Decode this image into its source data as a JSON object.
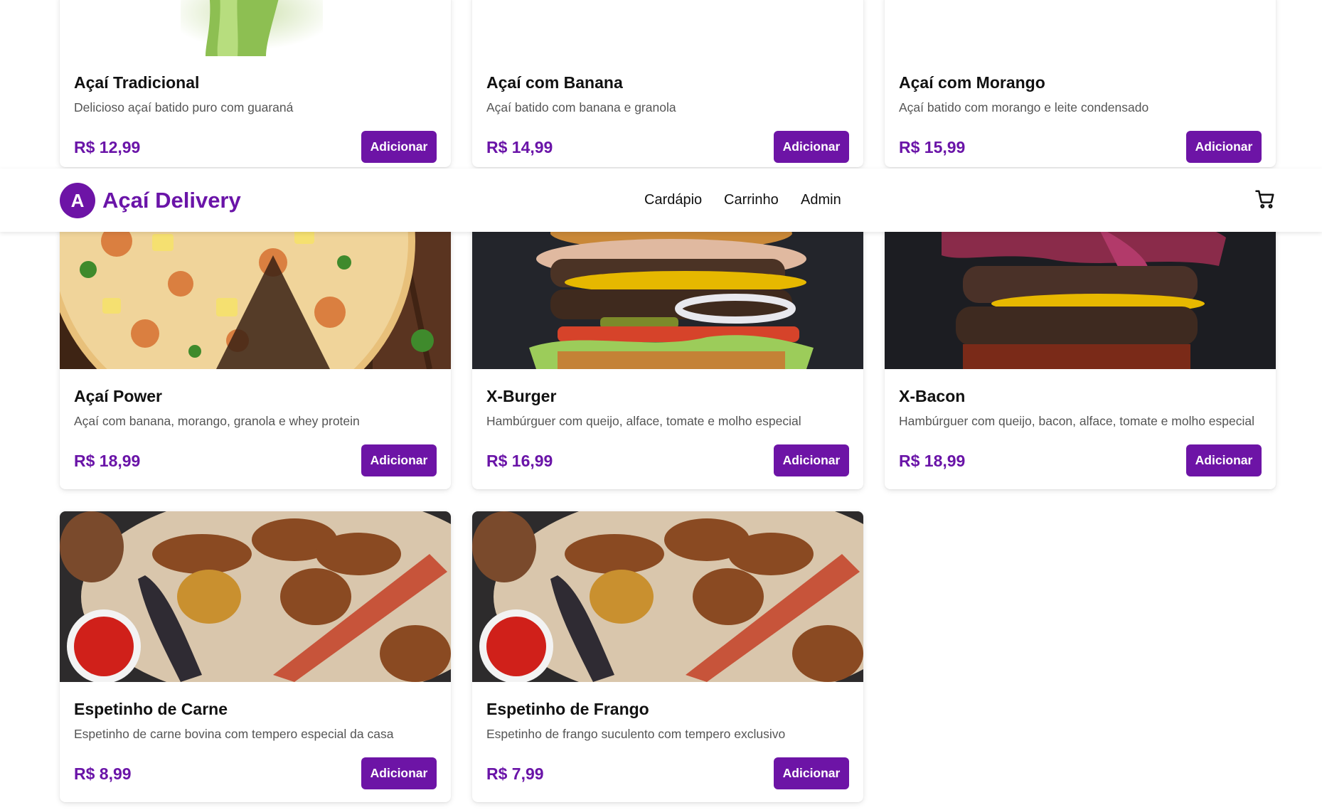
{
  "header": {
    "logo_letter": "A",
    "brand": "Açaí Delivery",
    "nav": [
      "Cardápio",
      "Carrinho",
      "Admin"
    ]
  },
  "products": [
    {
      "name": "Açaí Tradicional",
      "description": "Delicioso açaí batido puro com guaraná",
      "price": "R$ 12,99",
      "button": "Adicionar",
      "image": "acai-image"
    },
    {
      "name": "Açaí com Banana",
      "description": "Açaí batido com banana e granola",
      "price": "R$ 14,99",
      "button": "Adicionar",
      "image": "acai-image"
    },
    {
      "name": "Açaí com Morango",
      "description": "Açaí batido com morango e leite condensado",
      "price": "R$ 15,99",
      "button": "Adicionar",
      "image": "acai-image"
    },
    {
      "name": "Açaí Power",
      "description": "Açaí com banana, morango, granola e whey protein",
      "price": "R$ 18,99",
      "button": "Adicionar",
      "image": "pizza-image"
    },
    {
      "name": "X-Burger",
      "description": "Hambúrguer com queijo, alface, tomate e molho especial",
      "price": "R$ 16,99",
      "button": "Adicionar",
      "image": "burger-image"
    },
    {
      "name": "X-Bacon",
      "description": "Hambúrguer com queijo, bacon, alface, tomate e molho especial",
      "price": "R$ 18,99",
      "button": "Adicionar",
      "image": "bacon-burger-image"
    },
    {
      "name": "Espetinho de Carne",
      "description": "Espetinho de carne bovina com tempero especial da casa",
      "price": "R$ 8,99",
      "button": "Adicionar",
      "image": "skewer-platter-image"
    },
    {
      "name": "Espetinho de Frango",
      "description": "Espetinho de frango suculento com tempero exclusivo",
      "price": "R$ 7,99",
      "button": "Adicionar",
      "image": "skewer-platter-image"
    }
  ],
  "colors": {
    "accent": "#6d14a6",
    "price": "#6a14a8"
  },
  "icons": {
    "cart": "shopping-cart-icon"
  }
}
